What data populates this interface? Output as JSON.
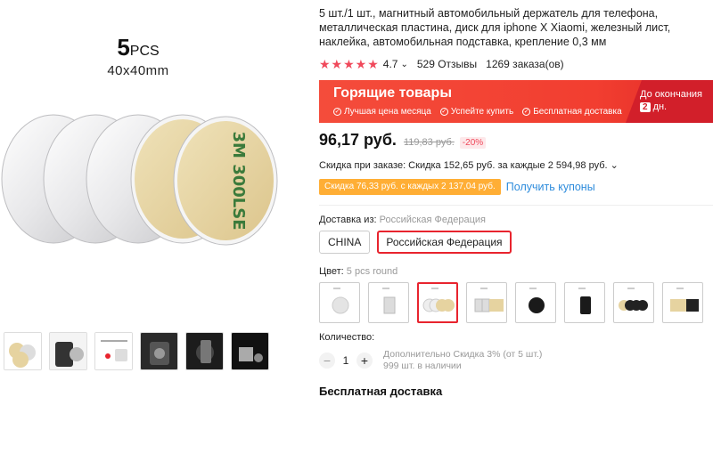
{
  "gallery": {
    "brand_main": "5",
    "brand_suffix": "PCS",
    "size": "40x40mm",
    "disc_text": "3M 300LSE"
  },
  "product": {
    "title": "5 шт./1 шт., магнитный автомобильный держатель для телефона, металлическая пластина, диск для iphone X Xiaomi, железный лист, наклейка, автомобильная подставка, крепление 0,3 мм",
    "stars": "★★★★★",
    "rating": "4.7",
    "rating_chevron": "⌄",
    "reviews": "529 Отзывы",
    "orders": "1269 заказа(ов)"
  },
  "banner": {
    "title": "Горящие товары",
    "features": [
      "Лучшая цена месяца",
      "Успейте купить",
      "Бесплатная доставка"
    ],
    "ends_label": "До окончания",
    "days_num": "2",
    "days_unit": "дн."
  },
  "pricing": {
    "price": "96,17 руб.",
    "old_price": "119,83 руб.",
    "discount": "-20%",
    "order_discount": "Скидка при заказе: Скидка 152,65 руб. за каждые 2 594,98 руб. ⌄",
    "coupon": "Скидка 76,33 руб. с каждых 2 137,04 руб.",
    "get_coupons": "Получить купоны"
  },
  "shipping": {
    "from_label": "Доставка из:",
    "from_value": "Российская Федерация",
    "options": [
      "CHINA",
      "Российская Федерация"
    ]
  },
  "color": {
    "label": "Цвет:",
    "value": "5 pcs round"
  },
  "quantity": {
    "label": "Количество:",
    "minus": "−",
    "value": "1",
    "plus": "+",
    "bulk_discount": "Дополнительно Скидка 3% (от 5 шт.)",
    "stock": "999 шт. в наличии"
  },
  "delivery": {
    "free": "Бесплатная доставка"
  },
  "colors": {
    "accent": "#e8242e",
    "star": "#f0495b",
    "coupon_bg": "#ffae35",
    "link": "#2e8cdc",
    "adhesive": "#e6d3a0"
  }
}
